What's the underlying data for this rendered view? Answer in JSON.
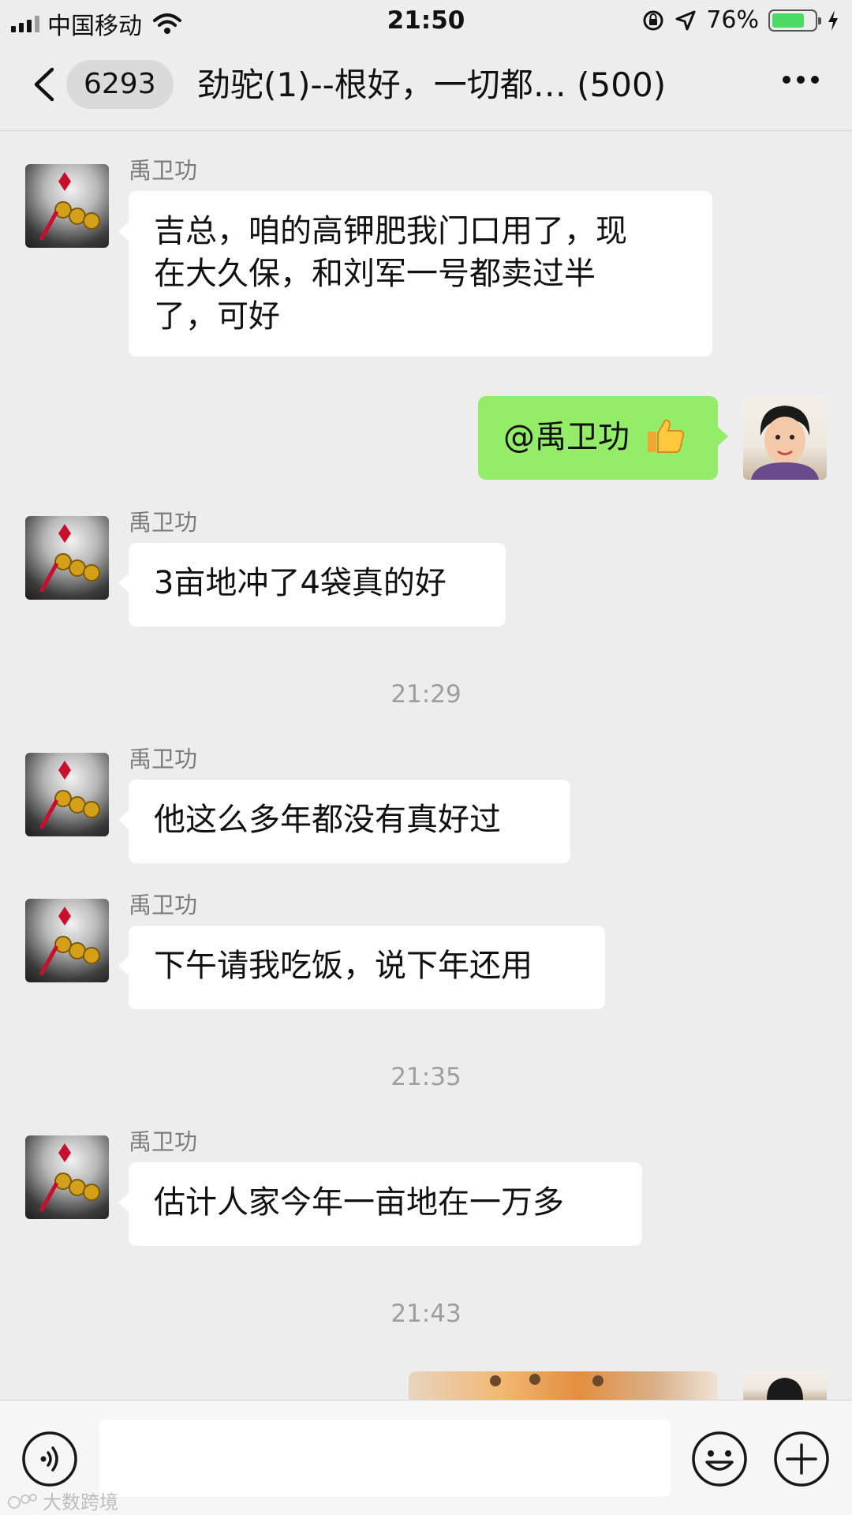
{
  "status_bar": {
    "carrier": "中国移动",
    "time": "21:50",
    "battery": "76%",
    "battery_level": 0.76,
    "battery_color": "#4cd964"
  },
  "nav": {
    "unread_count": "6293",
    "title": "劲驼(1)--根好，一切都…  (500)",
    "back_icon": "chevron-left-icon",
    "more_icon": "more-dots-icon"
  },
  "messages": [
    {
      "sender": "禹卫功",
      "lines": [
        "吉总，咱的高钾肥我门口用了，现",
        "在大久保，和刘军一号都卖过半",
        "了，可好"
      ]
    },
    {
      "sender": "me",
      "text": "@禹卫功",
      "emoji_icon": "thumbs-up-icon"
    },
    {
      "sender": "禹卫功",
      "text": "3亩地冲了4袋真的好"
    },
    {
      "timestamp": "21:29"
    },
    {
      "sender": "禹卫功",
      "text": "他这么多年都没有真好过"
    },
    {
      "sender": "禹卫功",
      "text": "下午请我吃饭，说下年还用"
    },
    {
      "timestamp": "21:35"
    },
    {
      "sender": "禹卫功",
      "text": "估计人家今年一亩地在一万多"
    },
    {
      "timestamp": "21:43"
    }
  ],
  "input_bar": {
    "placeholder": "",
    "voice_icon": "voice-icon",
    "emoji_icon": "emoji-icon",
    "plus_icon": "plus-icon"
  },
  "watermark": "大数跨境",
  "colors": {
    "background": "#ededed",
    "my_bubble": "#95ec69",
    "their_bubble": "#ffffff"
  }
}
